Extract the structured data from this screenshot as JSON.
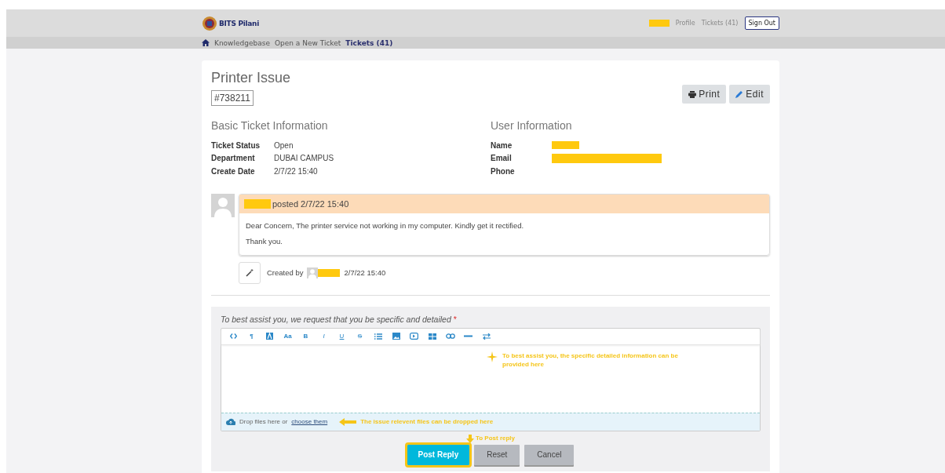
{
  "header": {
    "logo_text": "BITS Pilani",
    "user_redacted": true,
    "links": [
      "Profile",
      "Tickets (41)"
    ],
    "sign_out": "Sign Out"
  },
  "nav": [
    {
      "label": "Knowledgebase",
      "selected": false
    },
    {
      "label": "Open a New Ticket",
      "selected": false
    },
    {
      "label": "Tickets (41)",
      "selected": true
    }
  ],
  "ticket": {
    "title": "Printer Issue",
    "number": "#738211",
    "buttons": [
      {
        "kind": "print",
        "label": "Print"
      },
      {
        "kind": "edit",
        "label": "Edit"
      }
    ]
  },
  "basic_info": {
    "heading": "Basic Ticket Information",
    "rows": [
      {
        "label": "Ticket Status",
        "value": "Open"
      },
      {
        "label": "Department",
        "value": "DUBAI CAMPUS"
      },
      {
        "label": "Create Date",
        "value": "2/7/22 15:40"
      }
    ]
  },
  "user_info": {
    "heading": "User Information",
    "rows": [
      {
        "label": "Name",
        "redacted": true,
        "kind": "short"
      },
      {
        "label": "Email",
        "redacted": true,
        "kind": "long"
      },
      {
        "label": "Phone",
        "redacted": false
      }
    ]
  },
  "post": {
    "author_redacted": true,
    "header": "posted 2/7/22 15:40",
    "lines": [
      "Dear Concern, The printer service not working in my computer. Kindly get it rectified.",
      "Thank you."
    ]
  },
  "event": {
    "prefix": "Created by",
    "user_redacted": true,
    "time": "2/7/22 15:40"
  },
  "reply": {
    "label": "To best assist you, we request that you be specific and detailed",
    "required_mark": "*",
    "toolbar": [
      {
        "kind": "code"
      },
      {
        "kind": "glyph",
        "label": "¶"
      },
      {
        "kind": "highlight"
      },
      {
        "kind": "glyph",
        "label": "Aa"
      },
      {
        "kind": "glyph",
        "label": "B"
      },
      {
        "kind": "italic",
        "label": "I"
      },
      {
        "kind": "underline",
        "label": "U"
      },
      {
        "kind": "strike",
        "label": "S"
      },
      {
        "kind": "list"
      },
      {
        "kind": "image"
      },
      {
        "kind": "video"
      },
      {
        "kind": "table"
      },
      {
        "kind": "link"
      },
      {
        "kind": "rule"
      },
      {
        "kind": "direction"
      }
    ],
    "drop_text": "Drop files here or",
    "drop_link": "choose them",
    "buttons": [
      {
        "kind": "primary",
        "label": "Post Reply"
      },
      {
        "kind": "secondary",
        "label": "Reset"
      },
      {
        "kind": "secondary",
        "label": "Cancel"
      }
    ]
  },
  "annotations": [
    {
      "kind": "editor",
      "text": "To best assist you, the specific detailed information can be provided here"
    },
    {
      "kind": "drop",
      "text": "The issue relevent files can be dropped here"
    },
    {
      "kind": "post",
      "text": "To Post reply"
    }
  ]
}
